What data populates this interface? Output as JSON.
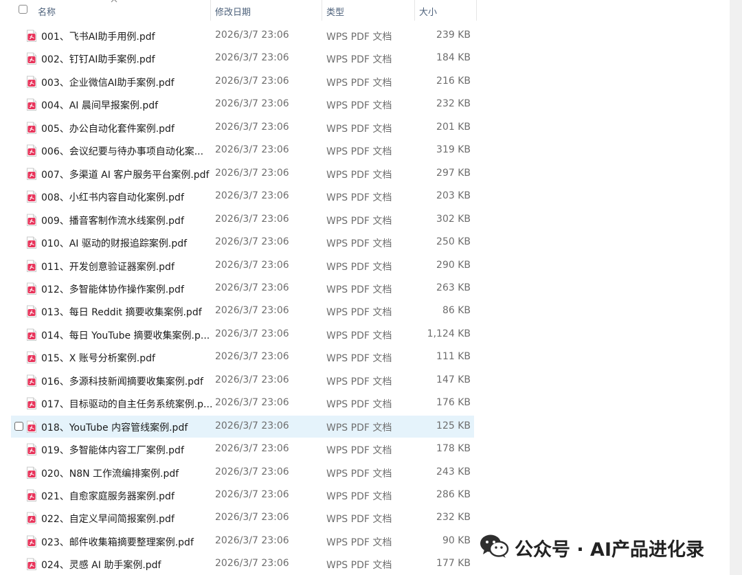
{
  "header": {
    "name": "名称",
    "date": "修改日期",
    "type": "类型",
    "size": "大小"
  },
  "files": [
    {
      "name": "001、飞书AI助手用例.pdf",
      "date": "2026/3/7 23:06",
      "type": "WPS PDF 文档",
      "size": "239 KB"
    },
    {
      "name": "002、钉钉AI助手案例.pdf",
      "date": "2026/3/7 23:06",
      "type": "WPS PDF 文档",
      "size": "184 KB"
    },
    {
      "name": "003、企业微信AI助手案例.pdf",
      "date": "2026/3/7 23:06",
      "type": "WPS PDF 文档",
      "size": "216 KB"
    },
    {
      "name": "004、AI 晨间早报案例.pdf",
      "date": "2026/3/7 23:06",
      "type": "WPS PDF 文档",
      "size": "232 KB"
    },
    {
      "name": "005、办公自动化套件案例.pdf",
      "date": "2026/3/7 23:06",
      "type": "WPS PDF 文档",
      "size": "201 KB"
    },
    {
      "name": "006、会议纪要与待办事项自动化案...",
      "date": "2026/3/7 23:06",
      "type": "WPS PDF 文档",
      "size": "319 KB"
    },
    {
      "name": "007、多渠道 AI 客户服务平台案例.pdf",
      "date": "2026/3/7 23:06",
      "type": "WPS PDF 文档",
      "size": "297 KB"
    },
    {
      "name": "008、小红书内容自动化案例.pdf",
      "date": "2026/3/7 23:06",
      "type": "WPS PDF 文档",
      "size": "203 KB"
    },
    {
      "name": "009、播音客制作流水线案例.pdf",
      "date": "2026/3/7 23:06",
      "type": "WPS PDF 文档",
      "size": "302 KB"
    },
    {
      "name": "010、AI 驱动的财报追踪案例.pdf",
      "date": "2026/3/7 23:06",
      "type": "WPS PDF 文档",
      "size": "250 KB"
    },
    {
      "name": "011、开发创意验证器案例.pdf",
      "date": "2026/3/7 23:06",
      "type": "WPS PDF 文档",
      "size": "290 KB"
    },
    {
      "name": "012、多智能体协作操作案例.pdf",
      "date": "2026/3/7 23:06",
      "type": "WPS PDF 文档",
      "size": "263 KB"
    },
    {
      "name": "013、每日 Reddit 摘要收集案例.pdf",
      "date": "2026/3/7 23:06",
      "type": "WPS PDF 文档",
      "size": "86 KB"
    },
    {
      "name": "014、每日 YouTube 摘要收集案例.p...",
      "date": "2026/3/7 23:06",
      "type": "WPS PDF 文档",
      "size": "1,124 KB"
    },
    {
      "name": "015、X 账号分析案例.pdf",
      "date": "2026/3/7 23:06",
      "type": "WPS PDF 文档",
      "size": "111 KB"
    },
    {
      "name": "016、多源科技新闻摘要收集案例.pdf",
      "date": "2026/3/7 23:06",
      "type": "WPS PDF 文档",
      "size": "147 KB"
    },
    {
      "name": "017、目标驱动的自主任务系统案例.p...",
      "date": "2026/3/7 23:06",
      "type": "WPS PDF 文档",
      "size": "176 KB"
    },
    {
      "name": "018、YouTube 内容管线案例.pdf",
      "date": "2026/3/7 23:06",
      "type": "WPS PDF 文档",
      "size": "125 KB",
      "selected": true
    },
    {
      "name": "019、多智能体内容工厂案例.pdf",
      "date": "2026/3/7 23:06",
      "type": "WPS PDF 文档",
      "size": "178 KB"
    },
    {
      "name": "020、N8N 工作流编排案例.pdf",
      "date": "2026/3/7 23:06",
      "type": "WPS PDF 文档",
      "size": "243 KB"
    },
    {
      "name": "021、自愈家庭服务器案例.pdf",
      "date": "2026/3/7 23:06",
      "type": "WPS PDF 文档",
      "size": "286 KB"
    },
    {
      "name": "022、自定义早间简报案例.pdf",
      "date": "2026/3/7 23:06",
      "type": "WPS PDF 文档",
      "size": "232 KB"
    },
    {
      "name": "023、邮件收集箱摘要整理案例.pdf",
      "date": "2026/3/7 23:06",
      "type": "WPS PDF 文档",
      "size": "90 KB"
    },
    {
      "name": "024、灵感 AI 助手案例.pdf",
      "date": "2026/3/7 23:06",
      "type": "WPS PDF 文档",
      "size": "177 KB"
    }
  ],
  "watermark": {
    "text": "公众号 · AI产品进化录",
    "icon": "wechat-icon"
  },
  "colors": {
    "pdf_icon": "#e8335a",
    "selected_row": "#e5f3fb",
    "header_text": "#4c607a"
  }
}
